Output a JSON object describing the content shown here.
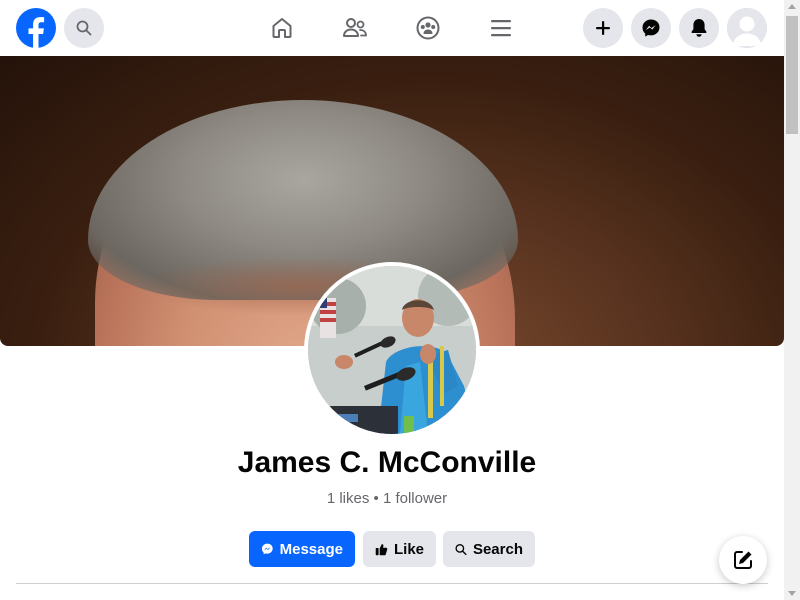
{
  "header": {
    "logo_icon": "facebook-logo-icon",
    "search_icon": "search-icon",
    "nav": [
      {
        "icon": "home-icon"
      },
      {
        "icon": "friends-icon"
      },
      {
        "icon": "groups-icon"
      },
      {
        "icon": "menu-icon"
      }
    ],
    "actions": [
      {
        "icon": "plus-icon"
      },
      {
        "icon": "messenger-icon"
      },
      {
        "icon": "bell-icon"
      },
      {
        "icon": "account-avatar"
      }
    ]
  },
  "profile": {
    "name": "James C. McConville",
    "stats": "1 likes • 1 follower"
  },
  "buttons": {
    "message": "Message",
    "like": "Like",
    "search": "Search"
  },
  "colors": {
    "brand": "#0866FF",
    "button_gray": "#E4E6EB",
    "text_secondary": "#65676B"
  }
}
